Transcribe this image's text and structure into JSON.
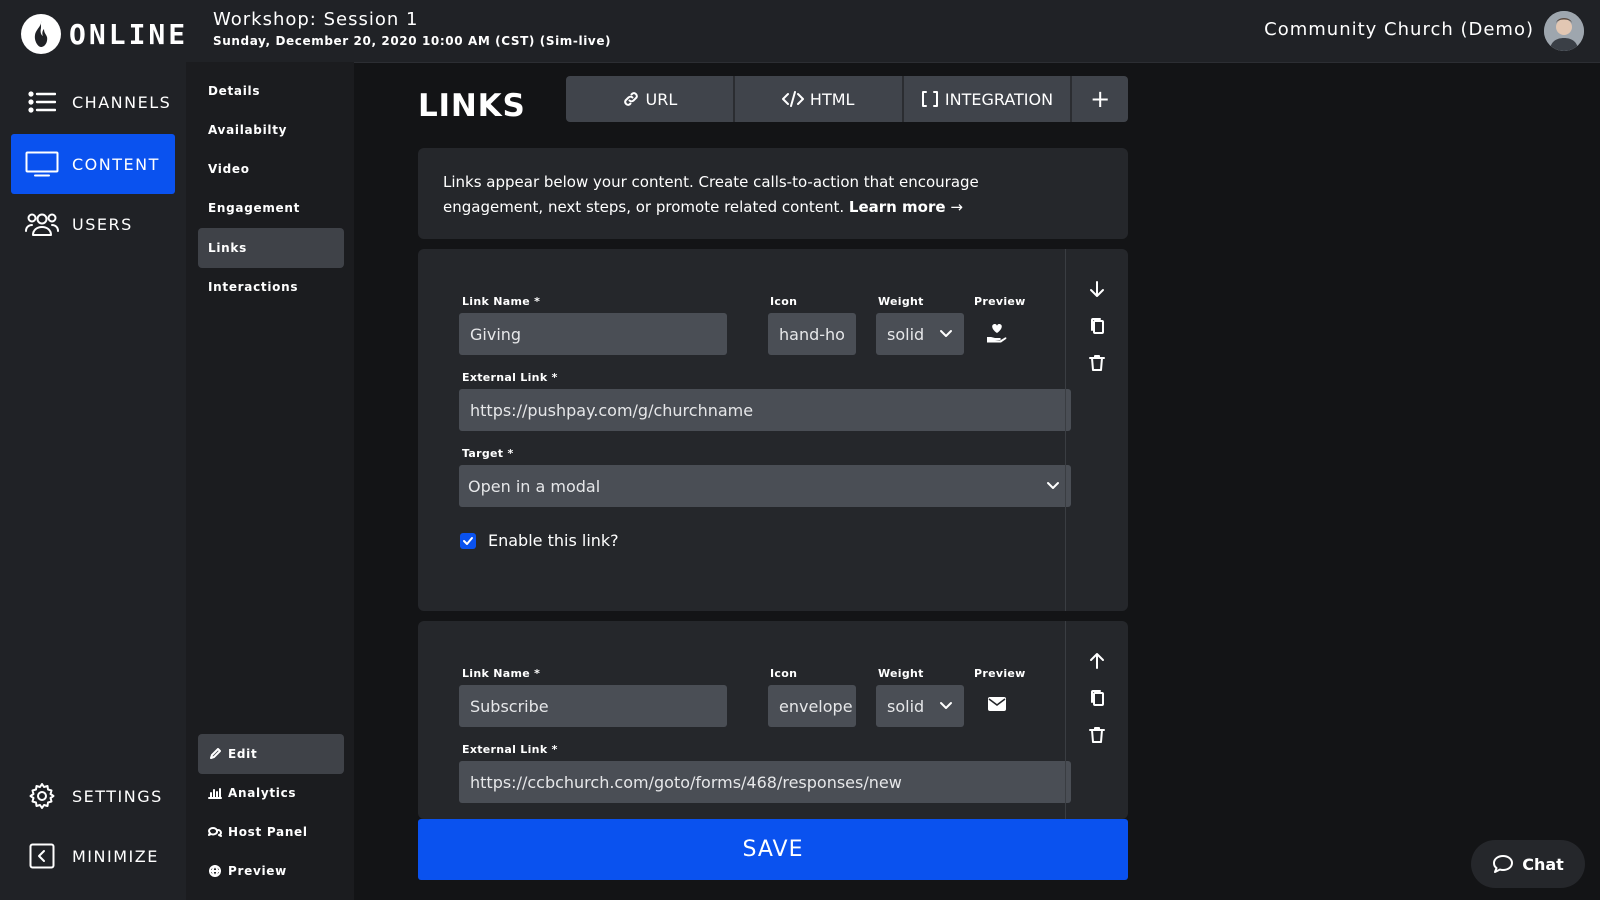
{
  "brand": {
    "name": "ONLINE",
    "accent": "#0a52ef"
  },
  "header": {
    "title": "Workshop: Session 1",
    "subtitle": "Sunday, December 20, 2020 10:00 AM (CST) (Sim-live)",
    "org": "Community Church (Demo)"
  },
  "nav": {
    "items": [
      {
        "label": "CHANNELS",
        "icon": "list-icon"
      },
      {
        "label": "CONTENT",
        "icon": "monitor-icon",
        "active": true
      },
      {
        "label": "USERS",
        "icon": "users-icon"
      }
    ],
    "bottom": [
      {
        "label": "SETTINGS",
        "icon": "gear-icon"
      },
      {
        "label": "MINIMIZE",
        "icon": "minimize-icon"
      }
    ]
  },
  "subnav": {
    "items": [
      "Details",
      "Availabilty",
      "Video",
      "Engagement",
      "Links",
      "Interactions"
    ],
    "active": "Links",
    "bottom": [
      {
        "label": "Edit",
        "icon": "pencil-icon",
        "active": true
      },
      {
        "label": "Analytics",
        "icon": "analytics-icon"
      },
      {
        "label": "Host Panel",
        "icon": "chat-bubbles-icon"
      },
      {
        "label": "Preview",
        "icon": "globe-icon"
      }
    ]
  },
  "page": {
    "title": "LINKS",
    "tabs": [
      {
        "label": "URL",
        "icon": "link-icon"
      },
      {
        "label": "HTML",
        "icon": "code-icon"
      },
      {
        "label": "INTEGRATION",
        "icon": "brackets-icon"
      },
      {
        "label": "+",
        "icon": "plus-icon"
      }
    ],
    "info_text": "Links appear below your content. Create calls-to-action that encourage engagement, next steps, or promote related content.",
    "learn_more": "Learn more",
    "learn_more_arrow": "→"
  },
  "labels": {
    "link_name": "Link Name *",
    "icon": "Icon",
    "weight": "Weight",
    "preview": "Preview",
    "external_link": "External Link *",
    "target": "Target *",
    "enable": "Enable this link?"
  },
  "links": [
    {
      "name": "Giving",
      "icon": "hand-ho",
      "weight": "solid",
      "preview_icon": "hand-holding-heart-icon",
      "url": "https://pushpay.com/g/churchname",
      "target": "Open in a modal",
      "enabled": true
    },
    {
      "name": "Subscribe",
      "icon": "envelope",
      "weight": "solid",
      "preview_icon": "envelope-icon",
      "url": "https://ccbchurch.com/goto/forms/468/responses/new"
    }
  ],
  "save_label": "SAVE",
  "chat_label": "Chat"
}
